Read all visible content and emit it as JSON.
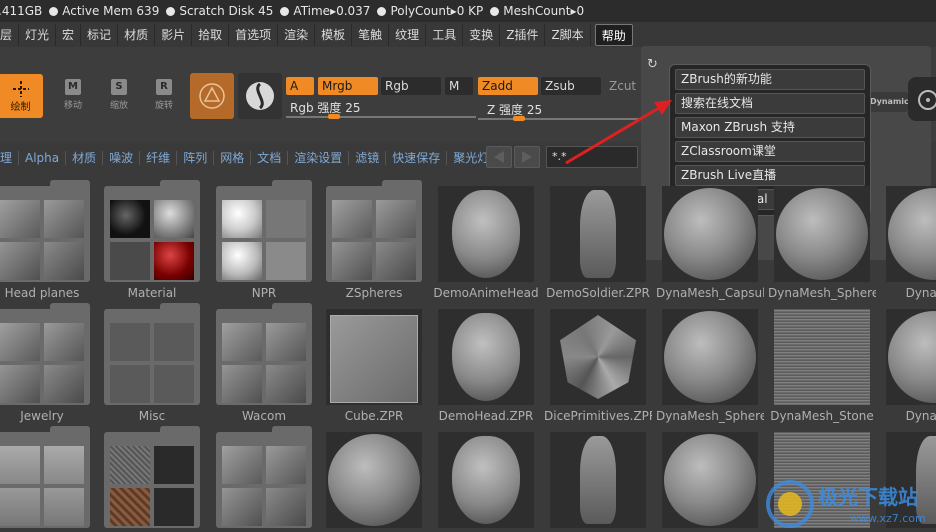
{
  "statusbar": {
    "items": [
      {
        "text": ".411GB",
        "dot": false
      },
      {
        "text": "Active Mem 639",
        "dot": true
      },
      {
        "text": "Scratch Disk 45",
        "dot": true
      },
      {
        "text": "ATime▸0.037",
        "dot": true
      },
      {
        "text": "PolyCount▸0 KP",
        "dot": true
      },
      {
        "text": "MeshCount▸0",
        "dot": true
      }
    ]
  },
  "menubar": {
    "items": [
      "层",
      "灯光",
      "宏",
      "标记",
      "材质",
      "影片",
      "拾取",
      "首选项",
      "渲染",
      "模板",
      "笔触",
      "纹理",
      "工具",
      "变换",
      "Z插件",
      "Z脚本",
      "帮助"
    ],
    "active": "帮助"
  },
  "shelf": {
    "draw_label": "绘制",
    "move_label": "移动",
    "scale_label": "缩放",
    "rotate_label": "旋转",
    "move_letter": "M",
    "scale_letter": "S",
    "rotate_letter": "R",
    "a_label": "A",
    "mrgb_label": "Mrgb",
    "rgb_label": "Rgb",
    "m_label": "M",
    "zadd_label": "Zadd",
    "zsub_label": "Zsub",
    "zcut_label": "Zcut",
    "rgb_intensity_label": "Rgb 强度 25",
    "z_intensity_label": "Z 强度 25",
    "rgb_intensity": 25,
    "z_intensity": 25,
    "dynamic_label": "Dynamic"
  },
  "help_menu": {
    "items": [
      "ZBrush的新功能",
      "搜索在线文档",
      "Maxon ZBrush 支持",
      "ZClassroom课堂",
      "ZBrush Live直播",
      "ZBrushCentral"
    ]
  },
  "lightbox": {
    "tabs": [
      "理",
      "Alpha",
      "材质",
      "噪波",
      "纤维",
      "阵列",
      "网格",
      "文档",
      "渲染设置",
      "滤镜",
      "快速保存",
      "聚光灯"
    ],
    "search_value": "*.*",
    "rows": [
      [
        "Head planes",
        "Material",
        "NPR",
        "ZSpheres",
        "DemoAnimeHead",
        "DemoSoldier.ZPR",
        "DynaMesh_Capsule",
        "DynaMesh_Sphere",
        "DynaWax"
      ],
      [
        "Jewelry",
        "Misc",
        "Wacom",
        "Cube.ZPR",
        "DemoHead.ZPR",
        "DicePrimitives.ZPR",
        "DynaMesh_Sphere",
        "DynaMesh_Stone",
        "DynaWax"
      ],
      [
        "",
        "",
        "",
        "",
        "",
        "",
        "",
        "",
        ""
      ]
    ]
  },
  "watermark": {
    "text": "极光下载站",
    "url": "www.xz7.com"
  },
  "colors": {
    "accent": "#f08a24",
    "arrow": "#e02020",
    "tab_text": "#7fa9d6"
  }
}
